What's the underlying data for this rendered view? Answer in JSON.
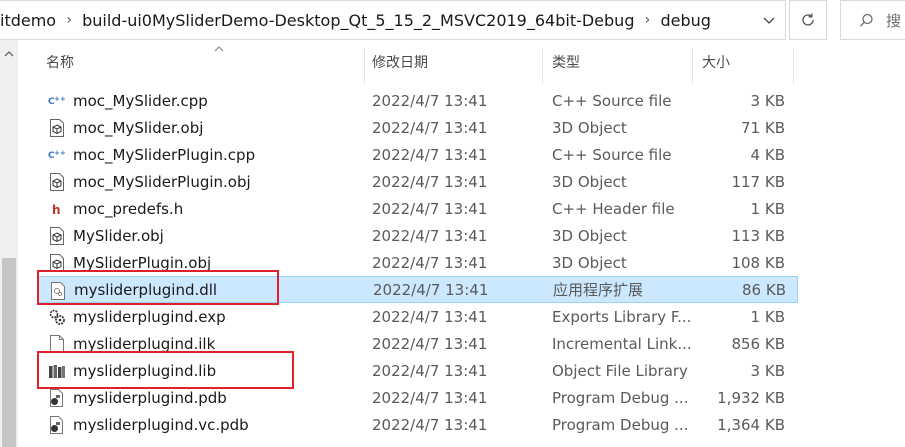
{
  "address": {
    "crumbs": [
      "itdemo",
      "build-ui0MySliderDemo-Desktop_Qt_5_15_2_MSVC2019_64bit-Debug",
      "debug"
    ],
    "separator": "›",
    "search_label": "搜"
  },
  "columns": {
    "name": "名称",
    "date": "修改日期",
    "type": "类型",
    "size": "大小"
  },
  "files": [
    {
      "name": "moc_MySlider.cpp",
      "date": "2022/4/7 13:41",
      "type": "C++ Source file",
      "size": "3 KB",
      "icon": "cpp-file-icon",
      "selected": false
    },
    {
      "name": "moc_MySlider.obj",
      "date": "2022/4/7 13:41",
      "type": "3D Object",
      "size": "71 KB",
      "icon": "3d-object-icon",
      "selected": false
    },
    {
      "name": "moc_MySliderPlugin.cpp",
      "date": "2022/4/7 13:41",
      "type": "C++ Source file",
      "size": "4 KB",
      "icon": "cpp-file-icon",
      "selected": false
    },
    {
      "name": "moc_MySliderPlugin.obj",
      "date": "2022/4/7 13:41",
      "type": "3D Object",
      "size": "117 KB",
      "icon": "3d-object-icon",
      "selected": false
    },
    {
      "name": "moc_predefs.h",
      "date": "2022/4/7 13:41",
      "type": "C++ Header file",
      "size": "1 KB",
      "icon": "header-file-icon",
      "selected": false
    },
    {
      "name": "MySlider.obj",
      "date": "2022/4/7 13:41",
      "type": "3D Object",
      "size": "113 KB",
      "icon": "3d-object-icon",
      "selected": false
    },
    {
      "name": "MySliderPlugin.obj",
      "date": "2022/4/7 13:41",
      "type": "3D Object",
      "size": "108 KB",
      "icon": "3d-object-icon",
      "selected": false
    },
    {
      "name": "mysliderplugind.dll",
      "date": "2022/4/7 13:41",
      "type": "应用程序扩展",
      "size": "86 KB",
      "icon": "dll-file-icon",
      "selected": true
    },
    {
      "name": "mysliderplugind.exp",
      "date": "2022/4/7 13:41",
      "type": "Exports Library F...",
      "size": "1 KB",
      "icon": "exp-file-icon",
      "selected": false
    },
    {
      "name": "mysliderplugind.ilk",
      "date": "2022/4/7 13:41",
      "type": "Incremental Link...",
      "size": "856 KB",
      "icon": "ilk-file-icon",
      "selected": false
    },
    {
      "name": "mysliderplugind.lib",
      "date": "2022/4/7 13:41",
      "type": "Object File Library",
      "size": "3 KB",
      "icon": "lib-file-icon",
      "selected": false
    },
    {
      "name": "mysliderplugind.pdb",
      "date": "2022/4/7 13:41",
      "type": "Program Debug ...",
      "size": "1,932 KB",
      "icon": "pdb-file-icon",
      "selected": false
    },
    {
      "name": "mysliderplugind.vc.pdb",
      "date": "2022/4/7 13:41",
      "type": "Program Debug ...",
      "size": "1,364 KB",
      "icon": "pdb-file-icon",
      "selected": false
    }
  ],
  "colors": {
    "selection_bg": "#cce8ff",
    "selection_border": "#99d1ff",
    "highlight_box": "#e0202a"
  }
}
